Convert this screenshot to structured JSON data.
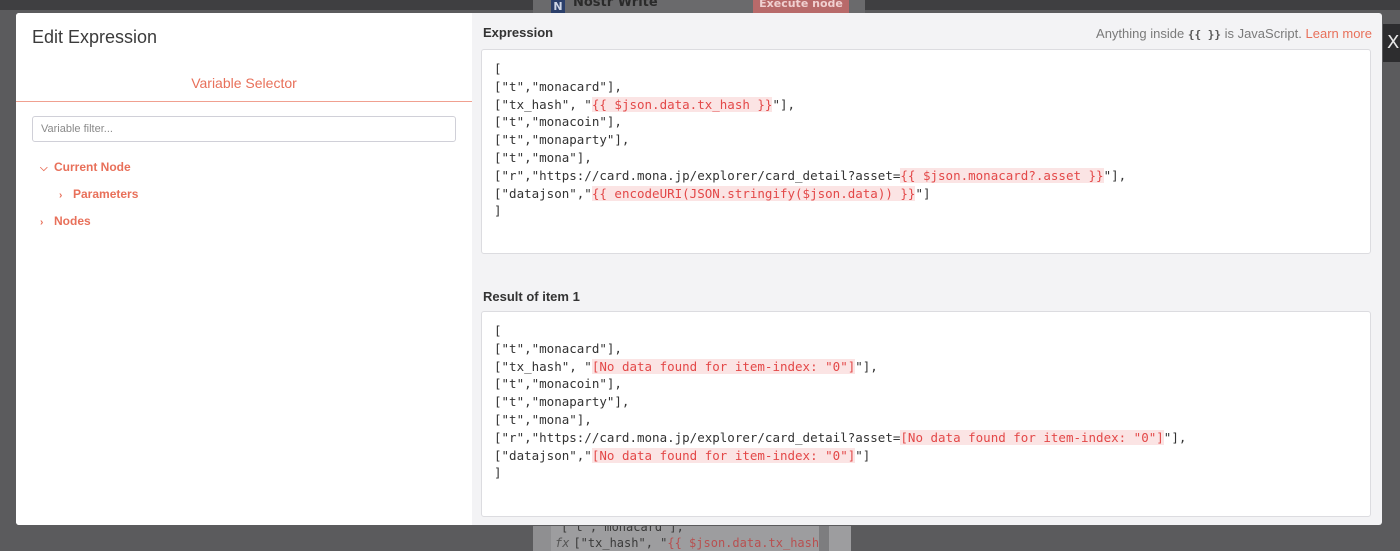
{
  "background": {
    "node_badge": "N",
    "node_title": "Nostr Write",
    "execute_button": "Execute node",
    "code_line_1": "[\"t\",\"monacard\"],",
    "code_line_2_prefix": "[\"tx_hash\", \"",
    "code_line_2_expr": "{{ $json.data.tx_hash",
    "fx_label": "fx",
    "close_glyph": "X"
  },
  "dialog": {
    "title": "Edit Expression",
    "variable_selector": {
      "tab_label": "Variable Selector",
      "filter_placeholder": "Variable filter...",
      "tree": [
        {
          "label": "Current Node",
          "expanded": true
        },
        {
          "label": "Parameters",
          "expanded": false
        },
        {
          "label": "Nodes",
          "expanded": false
        }
      ]
    },
    "expression": {
      "label": "Expression",
      "hint_prefix": "Anything inside",
      "hint_braces": "{{ }}",
      "hint_suffix": "is JavaScript.",
      "learn_more": "Learn more",
      "lines": [
        {
          "pre": "[",
          "hl": "",
          "post": ""
        },
        {
          "pre": "[\"t\",\"monacard\"],",
          "hl": "",
          "post": ""
        },
        {
          "pre": "[\"tx_hash\", \"",
          "hl": "{{ $json.data.tx_hash }}",
          "post": "\"],"
        },
        {
          "pre": "[\"t\",\"monacoin\"],",
          "hl": "",
          "post": ""
        },
        {
          "pre": "[\"t\",\"monaparty\"],",
          "hl": "",
          "post": ""
        },
        {
          "pre": "[\"t\",\"mona\"],",
          "hl": "",
          "post": ""
        },
        {
          "pre": "[\"r\",\"https://card.mona.jp/explorer/card_detail?asset=",
          "hl": "{{ $json.monacard?.asset }}",
          "post": "\"],"
        },
        {
          "pre": "[\"datajson\",\"",
          "hl": "{{ encodeURI(JSON.stringify($json.data)) }}",
          "post": "\"]"
        },
        {
          "pre": "]",
          "hl": "",
          "post": ""
        }
      ]
    },
    "result": {
      "label": "Result of item 1",
      "lines": [
        {
          "pre": "[",
          "hl": "",
          "post": ""
        },
        {
          "pre": "[\"t\",\"monacard\"],",
          "hl": "",
          "post": ""
        },
        {
          "pre": "[\"tx_hash\", \"",
          "hl": "[No data found for item-index: \"0\"]",
          "post": "\"],"
        },
        {
          "pre": "[\"t\",\"monacoin\"],",
          "hl": "",
          "post": ""
        },
        {
          "pre": "[\"t\",\"monaparty\"],",
          "hl": "",
          "post": ""
        },
        {
          "pre": "[\"t\",\"mona\"],",
          "hl": "",
          "post": ""
        },
        {
          "pre": "[\"r\",\"https://card.mona.jp/explorer/card_detail?asset=",
          "hl": "[No data found for item-index: \"0\"]",
          "post": "\"],"
        },
        {
          "pre": "[\"datajson\",\"",
          "hl": "[No data found for item-index: \"0\"]",
          "post": "\"]"
        },
        {
          "pre": "]",
          "hl": "",
          "post": ""
        }
      ]
    }
  },
  "colors": {
    "accent": "#e8705a",
    "highlight_text": "#e34848",
    "highlight_bg": "#fbe4e4",
    "overlay": "#5b5b5d"
  }
}
